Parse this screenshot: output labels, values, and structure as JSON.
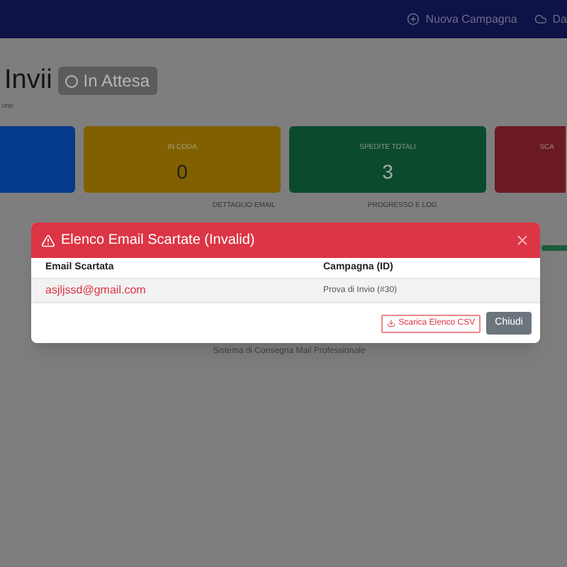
{
  "navbar": {
    "links": [
      {
        "label": "Nuova Campagna",
        "kind": "new"
      },
      {
        "label": "Da",
        "kind": "dash"
      }
    ]
  },
  "page": {
    "title": "Invii",
    "status_badge": "In Attesa",
    "subtitle": "one"
  },
  "stat_cards": [
    {
      "color": "#063a8a"
    },
    {
      "label": "IN CODA",
      "value": "0",
      "color": "#806000"
    },
    {
      "label": "SPEDITE TOTALI",
      "value": "3",
      "color": "#0c4a2e"
    },
    {
      "label": "SCA",
      "color": "#6b1a22"
    }
  ],
  "table": {
    "columns": [
      "DETTAGLIO EMAIL",
      "PROGRESSO E LOG"
    ]
  },
  "footer": "Sistema di Consegna Mail Professionale",
  "modal": {
    "title": "Elenco Email Scartate (Invalid)",
    "columns": [
      "Email Scartata",
      "Campagna (ID)"
    ],
    "rows": [
      {
        "email": "asjljssd@gmail.com",
        "campaign": "Prova di Invio (#30)"
      }
    ],
    "buttons": [
      {
        "label": "Scarica Elenco CSV",
        "kind": "outline"
      },
      {
        "label": "Chiudi",
        "kind": "secondary"
      }
    ]
  }
}
